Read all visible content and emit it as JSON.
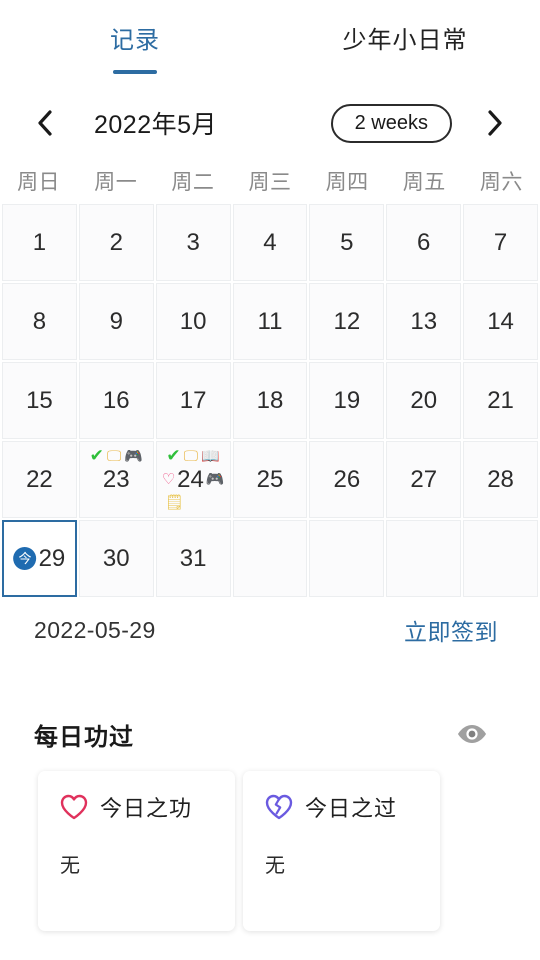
{
  "tabs": [
    {
      "label": "记录",
      "active": true
    },
    {
      "label": "少年小日常",
      "active": false
    }
  ],
  "calendar": {
    "prev_icon": "chevron-left-icon",
    "next_icon": "chevron-right-icon",
    "month_title": "2022年5月",
    "range_button": "2 weeks",
    "weekdays": [
      "周日",
      "周一",
      "周二",
      "周三",
      "周四",
      "周五",
      "周六"
    ],
    "weeks": [
      [
        {
          "day": "1"
        },
        {
          "day": "2"
        },
        {
          "day": "3"
        },
        {
          "day": "4"
        },
        {
          "day": "5"
        },
        {
          "day": "6"
        },
        {
          "day": "7"
        }
      ],
      [
        {
          "day": "8"
        },
        {
          "day": "9"
        },
        {
          "day": "10"
        },
        {
          "day": "11"
        },
        {
          "day": "12"
        },
        {
          "day": "13"
        },
        {
          "day": "14"
        }
      ],
      [
        {
          "day": "15"
        },
        {
          "day": "16"
        },
        {
          "day": "17"
        },
        {
          "day": "18"
        },
        {
          "day": "19"
        },
        {
          "day": "20"
        },
        {
          "day": "21"
        }
      ],
      [
        {
          "day": "22"
        },
        {
          "day": "23",
          "top_marks": [
            "✔",
            "🖵",
            "🎮"
          ],
          "mark_names": [
            "check-mark",
            "monitor-icon",
            "game-controller-icon"
          ]
        },
        {
          "day": "24",
          "top_marks": [
            "✔",
            "🖵",
            "📖"
          ],
          "left_mark": "♡",
          "right_mark": "🎮",
          "bottom_marks": [
            "🗒"
          ],
          "mark_names": [
            "check-mark",
            "monitor-icon",
            "book-icon",
            "heart-icon",
            "game-controller-icon",
            "note-icon"
          ]
        },
        {
          "day": "25"
        },
        {
          "day": "26"
        },
        {
          "day": "27"
        },
        {
          "day": "28"
        }
      ],
      [
        {
          "day": "29",
          "selected": true,
          "today_badge": "今"
        },
        {
          "day": "30"
        },
        {
          "day": "31"
        },
        {
          "day": ""
        },
        {
          "day": ""
        },
        {
          "day": ""
        },
        {
          "day": ""
        }
      ]
    ],
    "selected_date": "2022-05-29",
    "signin_label": "立即签到"
  },
  "section": {
    "title": "每日功过",
    "eye_icon": "eye-icon"
  },
  "cards": [
    {
      "icon": "heart-icon",
      "title": "今日之功",
      "body": "无",
      "color": "#e0315c"
    },
    {
      "icon": "broken-heart-icon",
      "title": "今日之过",
      "body": "无",
      "color": "#6a5ae0"
    }
  ],
  "colors": {
    "accent": "#2d6ca2",
    "today_badge": "#1f6bb0",
    "merit": "#e0315c",
    "fault": "#6a5ae0",
    "check": "#2fbf3a"
  }
}
